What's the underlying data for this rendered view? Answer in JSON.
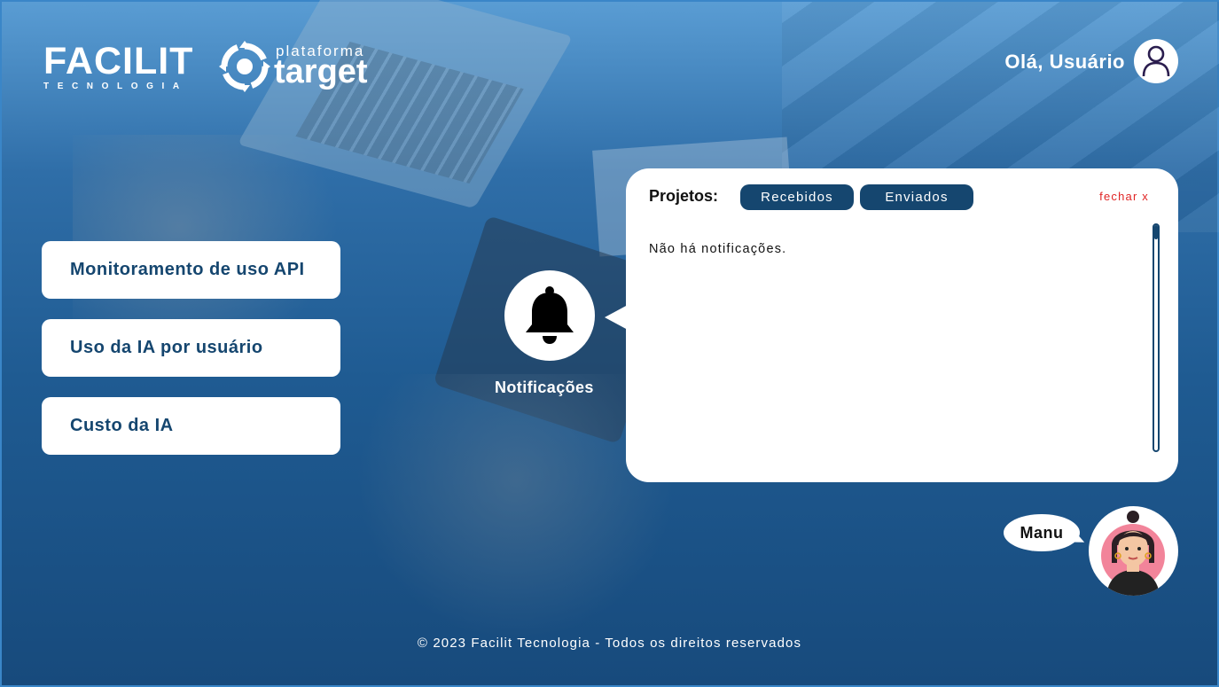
{
  "header": {
    "brand_name": "FACILIT",
    "brand_sub": "TECNOLOGIA",
    "platform_small": "plataforma",
    "platform_big": "target",
    "greeting": "Olá, Usuário"
  },
  "menu": {
    "items": [
      {
        "label": "Monitoramento de uso API"
      },
      {
        "label": "Uso da IA por usuário"
      },
      {
        "label": "Custo da IA"
      }
    ]
  },
  "notifications": {
    "label": "Notificações",
    "panel": {
      "title": "Projetos:",
      "tabs": [
        {
          "label": "Recebidos"
        },
        {
          "label": "Enviados"
        }
      ],
      "close_label": "fechar x",
      "empty_message": "Não há notificações."
    }
  },
  "assistant": {
    "name": "Manu"
  },
  "footer": {
    "text": "© 2023 Facilit Tecnologia - Todos os direitos reservados"
  },
  "colors": {
    "primary": "#15466f",
    "accent_red": "#e02424",
    "background_top": "#5a9dd4",
    "background_bottom": "#174a7c"
  }
}
